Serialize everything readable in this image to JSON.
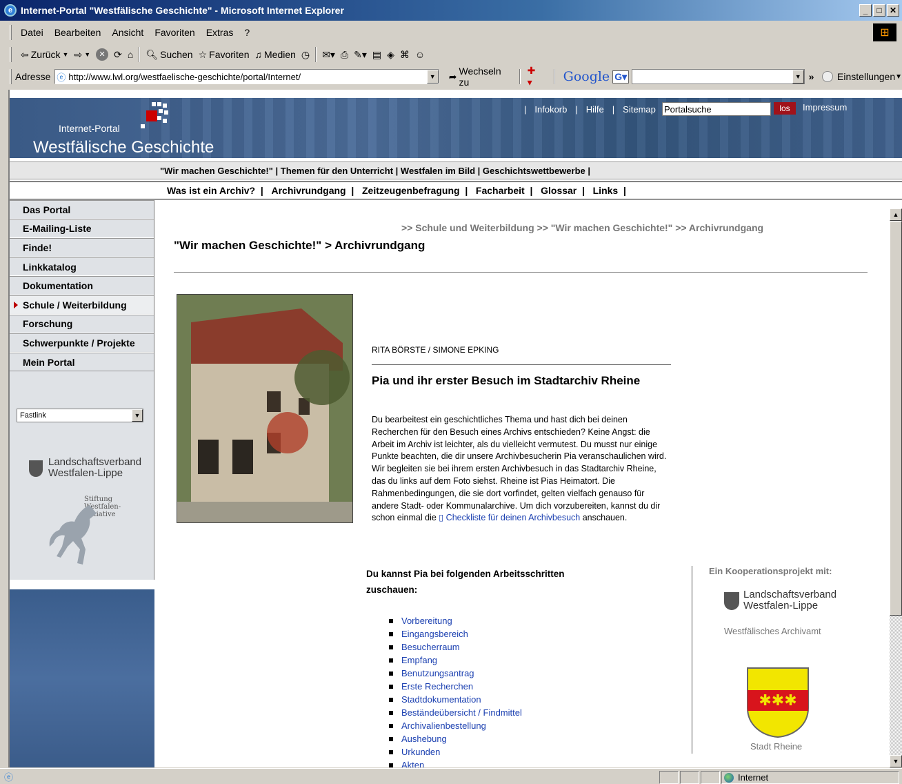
{
  "window": {
    "title": "Internet-Portal \"Westfälische Geschichte\" - Microsoft Internet Explorer"
  },
  "menu": [
    "Datei",
    "Bearbeiten",
    "Ansicht",
    "Favoriten",
    "Extras",
    "?"
  ],
  "toolbar": {
    "back": "Zurück",
    "search": "Suchen",
    "favorites": "Favoriten",
    "media": "Medien"
  },
  "address": {
    "label": "Adresse",
    "url": "http://www.lwl.org/westfaelische-geschichte/portal/Internet/",
    "go": "Wechseln zu"
  },
  "google": {
    "logo": "Google",
    "settings": "Einstellungen"
  },
  "banner": {
    "toplinks": [
      "Infokorb",
      "Hilfe",
      "Sitemap"
    ],
    "search_value": "Portalsuche",
    "search_button": "los",
    "impressum": "Impressum",
    "portal_small": "Internet-Portal",
    "portal_big": "Westfälische Geschichte"
  },
  "nav1": [
    "\"Wir machen Geschichte!\"",
    "Themen für den Unterricht",
    "Westfalen im Bild",
    "Geschichtswettbewerbe"
  ],
  "nav2": [
    "Was ist ein Archiv?",
    "Archivrundgang",
    "Zeitzeugenbefragung",
    "Facharbeit",
    "Glossar",
    "Links"
  ],
  "sidebar": {
    "items": [
      "Das Portal",
      "E-Mailing-Liste",
      "Finde!",
      "Linkkatalog",
      "Dokumentation",
      "Schule / Weiterbildung",
      "Forschung",
      "Schwerpunkte / Projekte",
      "Mein Portal"
    ],
    "active_index": 5,
    "fastlink": "Fastlink",
    "lwl_line1": "Landschaftsverband",
    "lwl_line2": "Westfalen-Lippe",
    "stiftung": [
      "Stiftung",
      "Westfalen-",
      "Initiative"
    ]
  },
  "content": {
    "breadcrumb": ">> Schule und Weiterbildung >> \"Wir machen Geschichte!\" >> Archivrundgang",
    "heading": "\"Wir machen Geschichte!\" > Archivrundgang",
    "authors": "RITA BÖRSTE / SIMONE EPKING",
    "article_title": "Pia und ihr erster Besuch im Stadtarchiv Rheine",
    "body": "Du bearbeitest ein geschichtliches Thema und hast dich bei deinen Recherchen für den Besuch eines Archivs entschieden? Keine Angst: die Arbeit im Archiv ist leichter, als du vielleicht vermutest. Du musst nur einige Punkte beachten, die dir unsere Archivbesucherin Pia veranschaulichen wird. Wir begleiten sie bei ihrem ersten Archivbesuch in das Stadtarchiv Rheine, das du links auf dem Foto siehst. Rheine ist Pias Heimatort. Die Rahmenbedingungen, die sie dort vorfindet, gelten vielfach genauso für andere Stadt- oder Kommunalarchive. Um dich vorzubereiten, kannst du dir schon einmal die",
    "checklist_link": "Checkliste für deinen Archivbesuch",
    "body_end": "anschauen.",
    "steps_heading": "Du kannst Pia bei folgenden Arbeitsschritten zuschauen:",
    "steps": [
      "Vorbereitung",
      "Eingangsbereich",
      "Besucherraum",
      "Empfang",
      "Benutzungsantrag",
      "Erste Recherchen",
      "Stadtdokumentation",
      "Beständeübersicht / Findmittel",
      "Archivalienbestellung",
      "Aushebung",
      "Urkunden",
      "Akten"
    ],
    "coop_heading": "Ein Kooperationsprojekt mit:",
    "coop_lwl1": "Landschaftsverband",
    "coop_lwl2": "Westfalen-Lippe",
    "coop_archivamt": "Westfälisches Archivamt",
    "coop_city": "Stadt Rheine"
  },
  "status": {
    "zone": "Internet"
  }
}
